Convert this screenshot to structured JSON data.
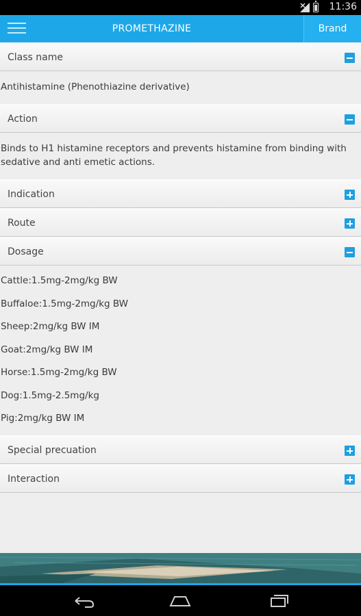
{
  "status_bar": {
    "time": "11:36"
  },
  "action_bar": {
    "title": "PROMETHAZINE",
    "brand_button": "Brand"
  },
  "sections": [
    {
      "title": "Class name",
      "expanded": true,
      "body": "Antihistamine (Phenothiazine derivative)"
    },
    {
      "title": "Action",
      "expanded": true,
      "body": "Binds to H1 histamine receptors and prevents histamine from binding with sedative and anti emetic actions."
    },
    {
      "title": "Indication",
      "expanded": false
    },
    {
      "title": "Route",
      "expanded": false
    },
    {
      "title": "Dosage",
      "expanded": true,
      "lines": [
        "Cattle:1.5mg-2mg/kg BW",
        "Buffaloe:1.5mg-2mg/kg BW",
        "Sheep:2mg/kg BW IM",
        "Goat:2mg/kg BW IM",
        "Horse:1.5mg-2mg/kg BW",
        "Dog:1.5mg-2.5mg/kg",
        "Pig:2mg/kg BW IM"
      ]
    },
    {
      "title": "Special precuation",
      "expanded": false
    },
    {
      "title": "Interaction",
      "expanded": false
    }
  ],
  "colors": {
    "accent": "#1ea7e8",
    "toggle": "#1d9fe0"
  },
  "icons": [
    "menu-icon",
    "minus-icon",
    "plus-icon",
    "back-icon",
    "home-icon",
    "recents-icon"
  ]
}
